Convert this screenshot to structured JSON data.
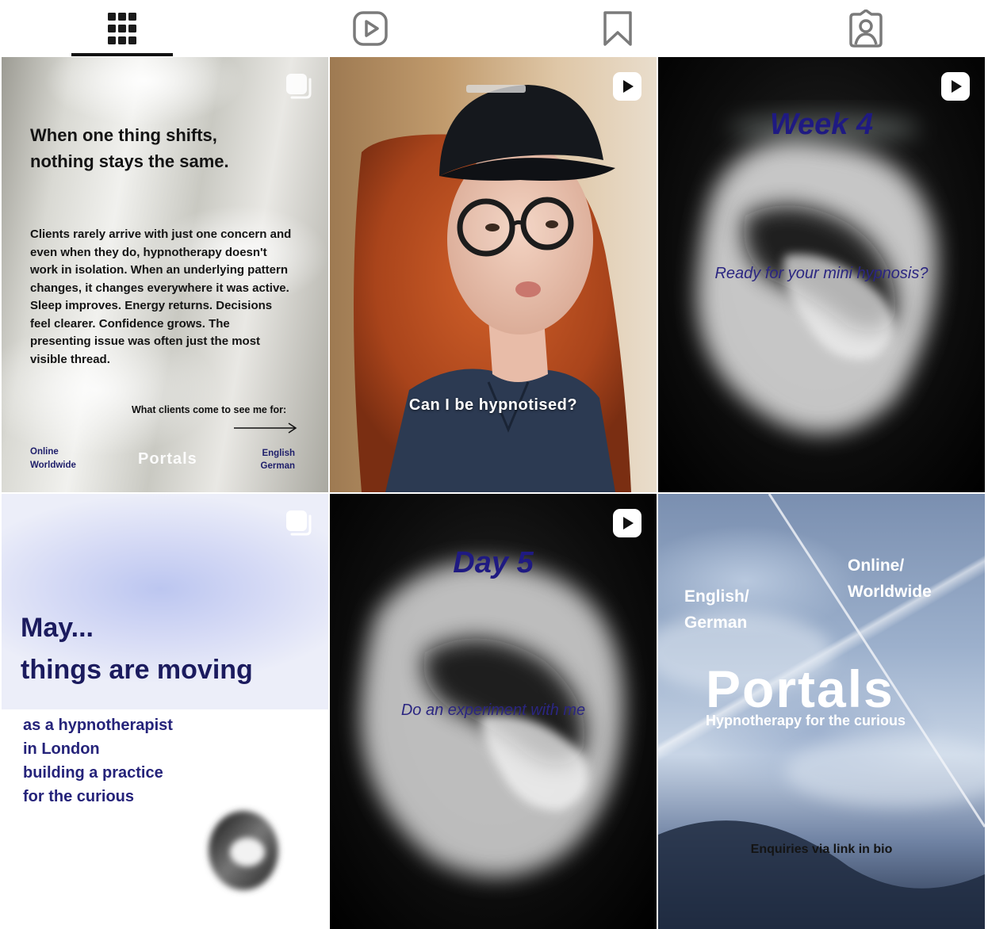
{
  "tabs": [
    {
      "name": "posts",
      "icon": "grid-icon",
      "active": true
    },
    {
      "name": "reels",
      "icon": "reels-icon",
      "active": false
    },
    {
      "name": "saved",
      "icon": "bookmark-icon",
      "active": false
    },
    {
      "name": "tagged",
      "icon": "tagged-user-icon",
      "active": false
    }
  ],
  "posts": [
    {
      "kind": "carousel",
      "heading_line1": "When one thing shifts,",
      "heading_line2": "nothing stays the same.",
      "body": "Clients rarely arrive with just one concern and even when they do, hypnotherapy doesn't work in isolation. When an underlying pattern changes, it changes everywhere it was active. Sleep improves. Energy returns. Decisions feel clearer. Confidence grows. The presenting issue was often just the most visible thread.",
      "cta": "What clients come to see me for:",
      "left_line1": "Online",
      "left_line2": "Worldwide",
      "logo": "Portals",
      "right_line1": "English",
      "right_line2": "German"
    },
    {
      "kind": "reel",
      "caption": "Can I be hypnotised?"
    },
    {
      "kind": "reel",
      "title": "Week 4",
      "subtitle": "Ready for your mini hypnosis?"
    },
    {
      "kind": "carousel",
      "heading_line1": "May...",
      "heading_line2": "things are moving",
      "line1": "as a hypnotherapist",
      "line2": "in London",
      "line3": "building a practice",
      "line4": "for the curious"
    },
    {
      "kind": "reel",
      "title": "Day 5",
      "subtitle": "Do an experiment with me"
    },
    {
      "kind": "post",
      "top_left_line1": "English/",
      "top_left_line2": "German",
      "top_right_line1": "Online/",
      "top_right_line2": "Worldwide",
      "brand": "Portals",
      "tagline": "Hypnotherapy for the curious",
      "enquiries": "Enquiries via link in bio"
    }
  ],
  "colors": {
    "accent_navy": "#1f1a82",
    "text_dark": "#141414",
    "tab_active_indicator": "#111111"
  }
}
